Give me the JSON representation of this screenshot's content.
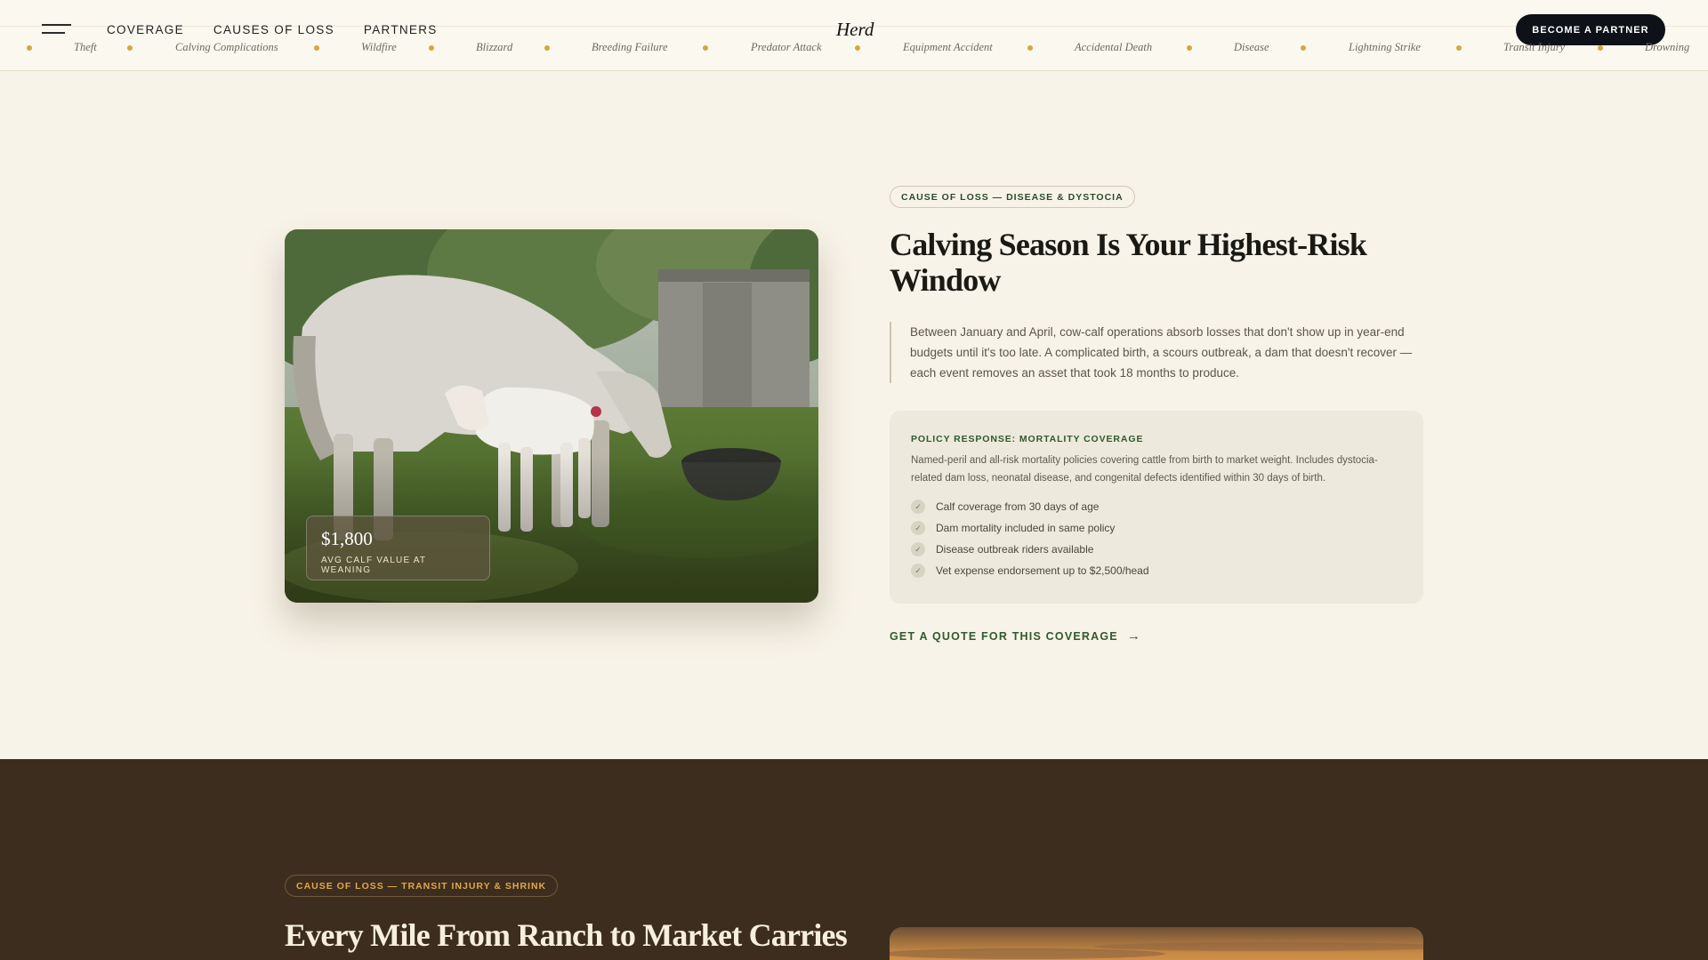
{
  "header": {
    "menu_icon": "menu-icon",
    "nav": [
      {
        "label": "COVERAGE"
      },
      {
        "label": "CAUSES OF LOSS"
      },
      {
        "label": "PARTNERS"
      }
    ],
    "logo": "Herd",
    "cta": "BECOME A PARTNER"
  },
  "ticker": {
    "items": [
      "Theft",
      "Calving Complications",
      "Wildfire",
      "Blizzard",
      "Breeding Failure",
      "Predator Attack",
      "Equipment Accident",
      "Accidental Death",
      "Disease",
      "Lightning Strike",
      "Transit Injury",
      "Drowning"
    ],
    "dot_color": "#d9a441"
  },
  "section1": {
    "tag": "CAUSE OF LOSS — DISEASE & DYSTOCIA",
    "heading": "Calving Season Is Your Highest-Risk Window",
    "quote": "Between January and April, cow-calf operations absorb losses that don't show up in year-end budgets until it's too late. A complicated birth, a scours outbreak, a dam that doesn't recover — each event removes an asset that took 18 months to produce.",
    "stat": {
      "value": "$1,800",
      "label": "AVG CALF VALUE AT WEANING"
    },
    "policy": {
      "title": "POLICY RESPONSE: MORTALITY COVERAGE",
      "description": "Named-peril and all-risk mortality policies covering cattle from birth to market weight. Includes dystocia-related dam loss, neonatal disease, and congenital defects identified within 30 days of birth.",
      "items": [
        {
          "text": "Calf coverage from 30 days of age"
        },
        {
          "text": "Dam mortality included in same policy"
        },
        {
          "text": "Disease outbreak riders available"
        },
        {
          "text": "Vet expense endorsement up to $2,500/head"
        }
      ]
    },
    "link": "GET A QUOTE FOR THIS COVERAGE"
  },
  "section2": {
    "tag": "CAUSE OF LOSS — TRANSIT INJURY & SHRINK",
    "heading": "Every Mile From Ranch to Market Carries"
  },
  "colors": {
    "accent_green": "#2f5a2e",
    "accent_gold": "#d9a441",
    "dark_brown": "#3d2d1e",
    "cream": "#f8f3e8"
  }
}
